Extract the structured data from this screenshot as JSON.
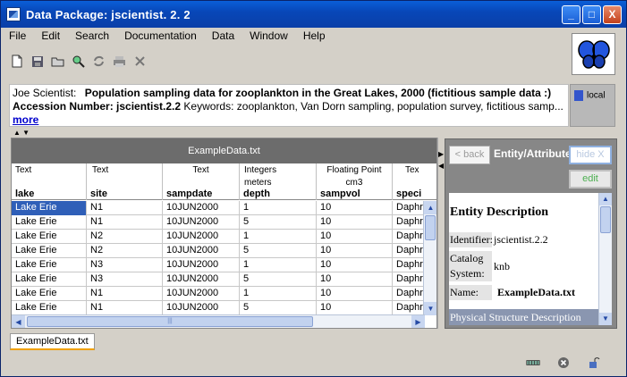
{
  "window": {
    "title": "Data Package:  jscientist. 2. 2",
    "controls": [
      "_",
      "□",
      "X"
    ]
  },
  "menu": [
    "File",
    "Edit",
    "Search",
    "Documentation",
    "Data",
    "Window",
    "Help"
  ],
  "toolbar": {
    "icons": [
      "new-package-icon",
      "save-icon",
      "open-icon",
      "search-icon",
      "synchronize-icon",
      "print-icon",
      "delete-icon"
    ]
  },
  "header": {
    "owner": "Joe Scientist:",
    "title": "Population sampling data for zooplankton in the Great Lakes, 2000 (fictitious sample data :)",
    "accession_label": "Accession Number: jscientist.2.2",
    "keywords": "Keywords: zooplankton, Van Dorn sampling, population survey, fictitious samp...",
    "more": "more",
    "location": "local"
  },
  "table": {
    "title": "ExampleData.txt",
    "columns": [
      {
        "type": "Text",
        "unit": "",
        "unit2": "",
        "name": "lake"
      },
      {
        "type": "Text",
        "unit": "",
        "unit2": "",
        "name": "site"
      },
      {
        "type": "Text",
        "unit": "",
        "unit2": "",
        "name": "sampdate"
      },
      {
        "type": "Integers",
        "unit": "meters",
        "unit2": "",
        "name": "depth"
      },
      {
        "type": "Floating Point",
        "unit": "cm3",
        "unit2": "",
        "name": "sampvol"
      },
      {
        "type": "Tex",
        "unit": "",
        "unit2": "",
        "name": "speci"
      }
    ],
    "rows": [
      [
        "Lake Erie",
        "N1",
        "10JUN2000",
        "1",
        "10",
        "Daphr"
      ],
      [
        "Lake Erie",
        "N1",
        "10JUN2000",
        "5",
        "10",
        "Daphr"
      ],
      [
        "Lake Erie",
        "N2",
        "10JUN2000",
        "1",
        "10",
        "Daphr"
      ],
      [
        "Lake Erie",
        "N2",
        "10JUN2000",
        "5",
        "10",
        "Daphr"
      ],
      [
        "Lake Erie",
        "N3",
        "10JUN2000",
        "1",
        "10",
        "Daphr"
      ],
      [
        "Lake Erie",
        "N3",
        "10JUN2000",
        "5",
        "10",
        "Daphr"
      ],
      [
        "Lake Erie",
        "N1",
        "10JUN2000",
        "1",
        "10",
        "Daphr"
      ],
      [
        "Lake Erie",
        "N1",
        "10JUN2000",
        "5",
        "10",
        "Daphr"
      ]
    ],
    "hscroll_grip": "|||"
  },
  "meta": {
    "back": "< back",
    "title": "Entity/Attribute",
    "hide": "hide X",
    "edit": "edit",
    "heading": "Entity Description",
    "identifier_label": "Identifier:",
    "identifier_value": "jscientist.2.2",
    "catalog_label": "Catalog System:",
    "catalog_value": "knb",
    "name_label": "Name:",
    "name_value": "ExampleData.txt",
    "section": "Physical Structure Description"
  },
  "tabs": [
    "ExampleData.txt"
  ]
}
